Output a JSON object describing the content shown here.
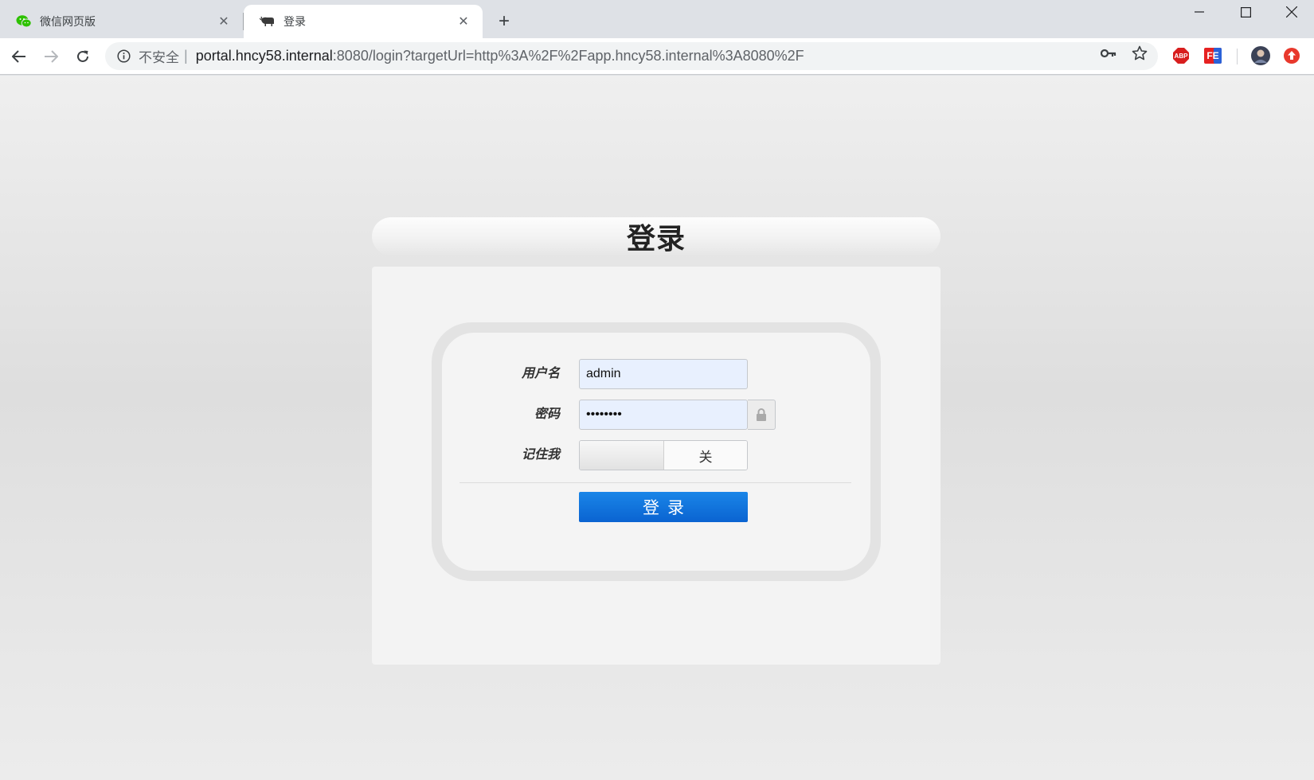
{
  "browser": {
    "tabs": [
      {
        "title": "微信网页版",
        "icon": "wechat-icon"
      },
      {
        "title": "登录",
        "icon": "yak-favicon-icon",
        "active": true
      }
    ],
    "address": {
      "security_label": "不安全",
      "separator": "|",
      "host": "portal.hncy58.internal",
      "path": ":8080/login?targetUrl=http%3A%2F%2Fapp.hncy58.internal%3A8080%2F"
    },
    "extensions": {
      "abp": "ABP",
      "fe": "FE"
    }
  },
  "login": {
    "title": "登录",
    "username_label": "用户名",
    "username_value": "admin",
    "password_label": "密码",
    "password_value": "12345678",
    "remember_label": "记住我",
    "remember_state": "关",
    "submit_label": "登录"
  },
  "colors": {
    "primary_button": "#0a63d1",
    "input_bg": "#e8f0fe",
    "abp_red": "#d81e1e",
    "update_red": "#e8382c"
  }
}
